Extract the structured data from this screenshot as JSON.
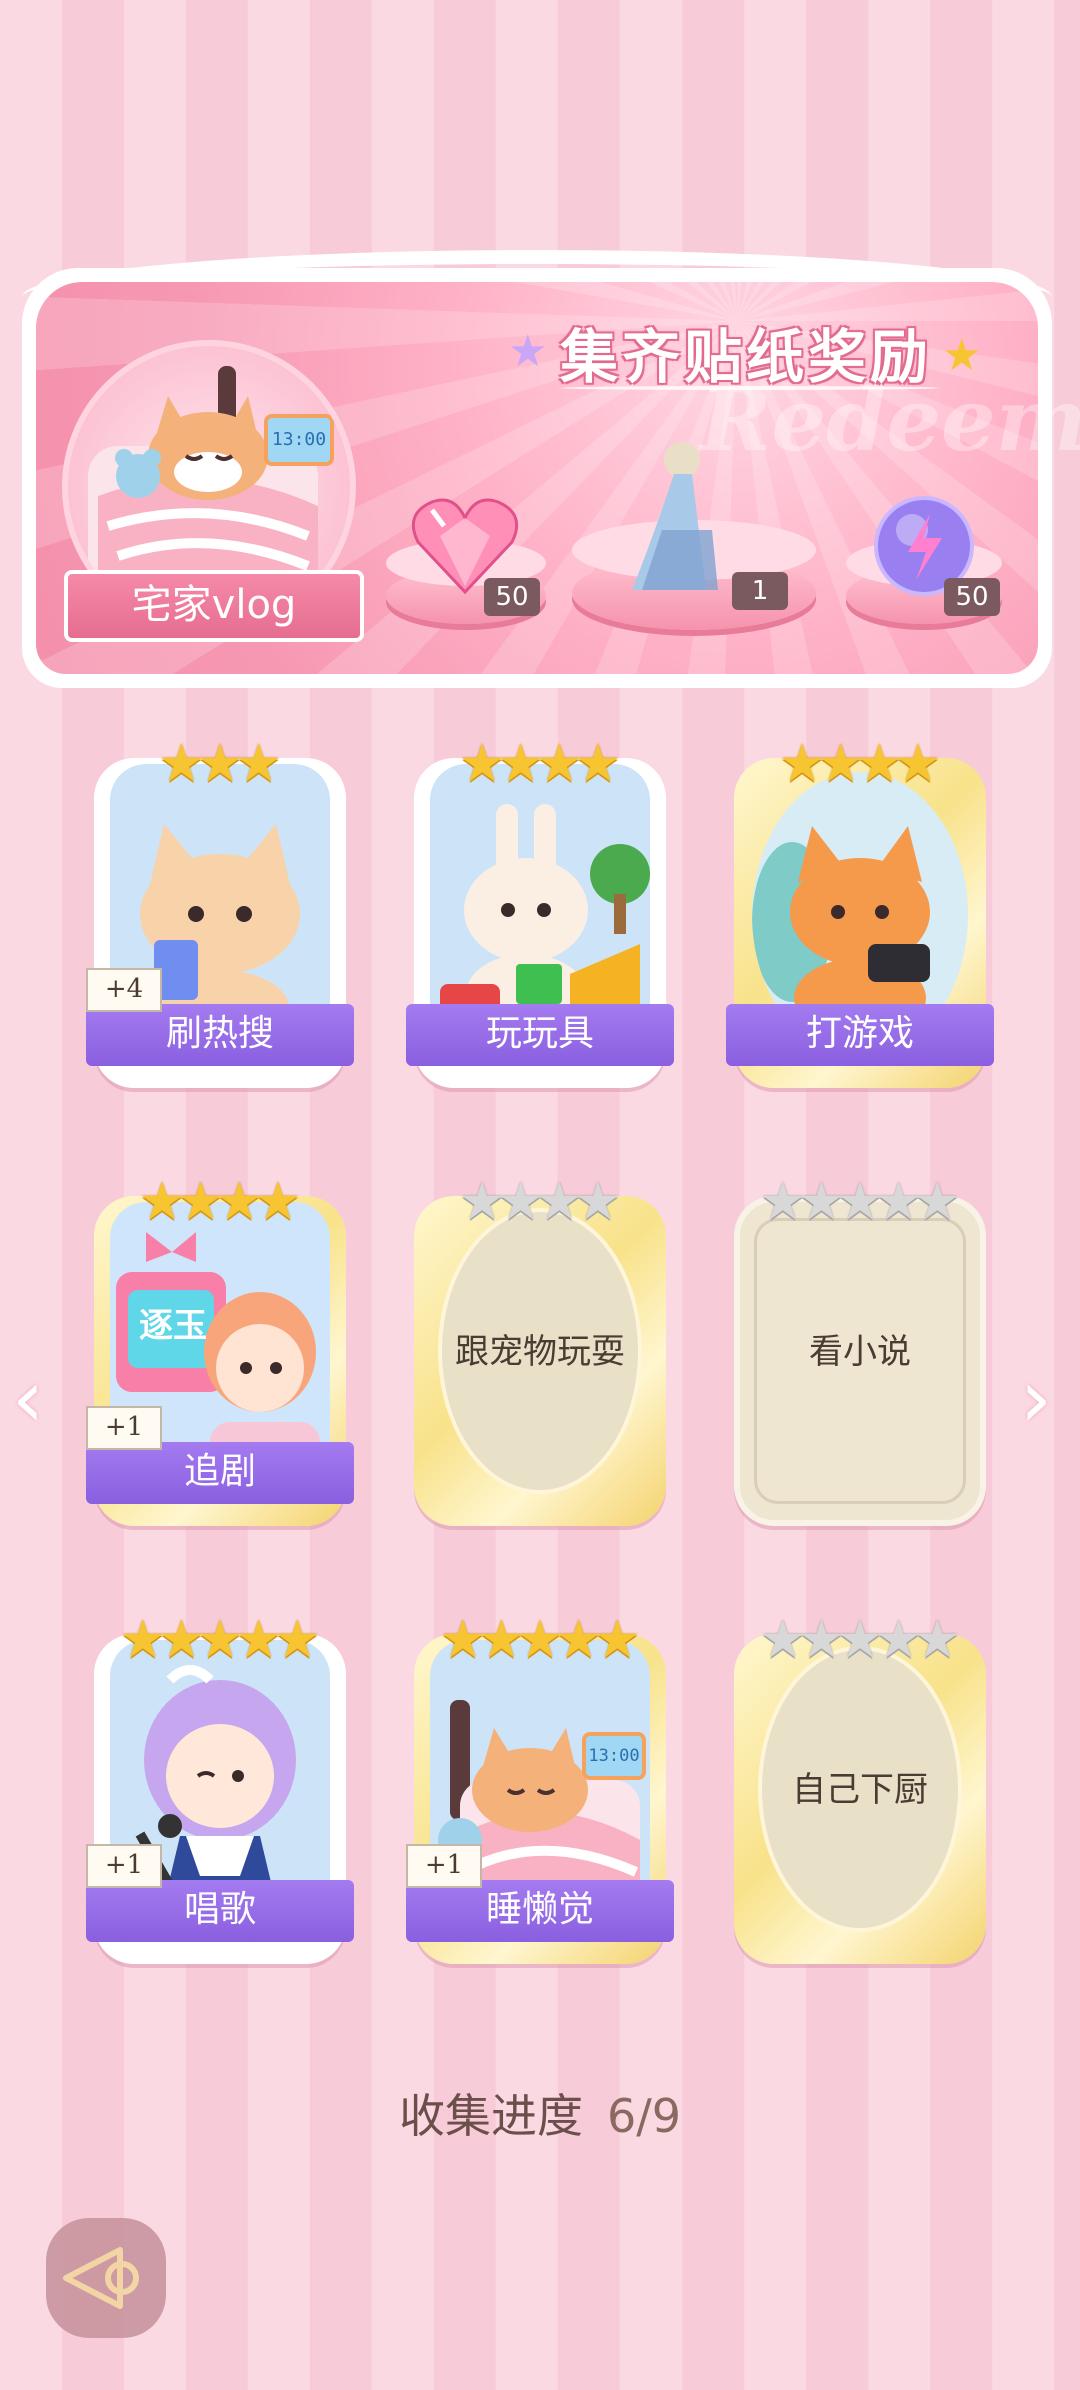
{
  "banner": {
    "title": "集齐贴纸奖励",
    "watermark": "Redeem",
    "stage_label": "宅家vlog",
    "rewards": [
      {
        "icon": "pink-heart-gem-icon",
        "count": "50"
      },
      {
        "icon": "outfit-figure-icon",
        "count": "1"
      },
      {
        "icon": "purple-energy-orb-icon",
        "count": "50"
      }
    ]
  },
  "cards": [
    {
      "label": "刷热搜",
      "stars_filled": 3,
      "stars_total": 3,
      "bonus": "+4",
      "collected": true
    },
    {
      "label": "玩玩具",
      "stars_filled": 4,
      "stars_total": 4,
      "bonus": "",
      "collected": true
    },
    {
      "label": "打游戏",
      "stars_filled": 4,
      "stars_total": 4,
      "bonus": "",
      "collected": true
    },
    {
      "label": "追剧",
      "stars_filled": 4,
      "stars_total": 4,
      "bonus": "+1",
      "collected": true
    },
    {
      "label": "跟宠物玩耍",
      "stars_filled": 0,
      "stars_total": 4,
      "bonus": "",
      "collected": false
    },
    {
      "label": "看小说",
      "stars_filled": 0,
      "stars_total": 5,
      "bonus": "",
      "collected": false
    },
    {
      "label": "唱歌",
      "stars_filled": 5,
      "stars_total": 5,
      "bonus": "+1",
      "collected": true
    },
    {
      "label": "睡懒觉",
      "stars_filled": 5,
      "stars_total": 5,
      "bonus": "+1",
      "collected": true
    },
    {
      "label": "自己下厨",
      "stars_filled": 0,
      "stars_total": 5,
      "bonus": "",
      "collected": false
    }
  ],
  "tv_text": "逐玉",
  "clock_text": "13:00",
  "progress": {
    "label": "收集进度",
    "value": "6/9",
    "collected": 6,
    "total": 9
  },
  "colors": {
    "ribbon": "#8a5fe0",
    "banner_pink": "#f799b3",
    "star_gold": "#f7c531"
  }
}
